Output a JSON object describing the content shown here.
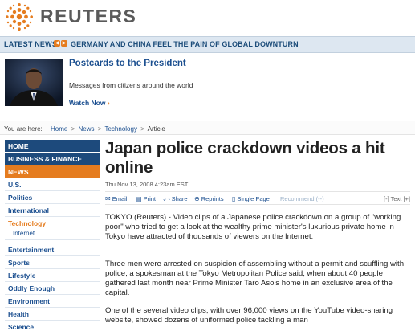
{
  "brand": {
    "name": "REUTERS",
    "color": "#e57c1f"
  },
  "ticker": {
    "label": "LATEST NEWS",
    "headline": "GERMANY AND CHINA FEEL THE PAIN OF GLOBAL DOWNTURN"
  },
  "promo": {
    "title": "Postcards to the President",
    "description": "Messages from citizens around the world",
    "link": "Watch Now",
    "link_arrow": "›"
  },
  "breadcrumb": {
    "label": "You are here:",
    "items": [
      "Home",
      "News",
      "Technology"
    ],
    "current": "Article",
    "separator": ">"
  },
  "nav": {
    "items": [
      {
        "label": "HOME",
        "style": "dark"
      },
      {
        "label": "BUSINESS & FINANCE",
        "style": "dark"
      },
      {
        "label": "NEWS",
        "style": "orange"
      },
      {
        "label": "U.S.",
        "style": "plain"
      },
      {
        "label": "Politics",
        "style": "plain"
      },
      {
        "label": "International",
        "style": "plain"
      },
      {
        "label": "Technology",
        "style": "selected"
      },
      {
        "label": "Internet",
        "style": "sub"
      },
      {
        "label": "Entertainment",
        "style": "plain-gap"
      },
      {
        "label": "Sports",
        "style": "plain"
      },
      {
        "label": "Lifestyle",
        "style": "plain"
      },
      {
        "label": "Oddly Enough",
        "style": "plain"
      },
      {
        "label": "Environment",
        "style": "plain"
      },
      {
        "label": "Health",
        "style": "plain"
      },
      {
        "label": "Science",
        "style": "plain"
      }
    ]
  },
  "article": {
    "title": "Japan police crackdown videos a hit online",
    "date": "Thu Nov 13, 2008 4:23am EST",
    "tools": {
      "email": "Email",
      "print": "Print",
      "share": "Share",
      "reprints": "Reprints",
      "single_page": "Single Page",
      "recommend": "Recommend (--)",
      "text_size": "[-] Text [+]"
    },
    "paragraphs": [
      "TOKYO (Reuters) - Video clips of a Japanese police crackdown on a group of \"working poor\" who tried to get a look at the wealthy prime minister's luxurious private home in Tokyo have attracted of thousands of viewers on the Internet.",
      "Three men were arrested on suspicion of assembling without a permit and scuffling with police, a spokesman at the Tokyo Metropolitan Police said, when about 40 people gathered last month near Prime Minister Taro Aso's home in an exclusive area of the capital.",
      "One of the several video clips, with over 96,000 views on the YouTube video-sharing website, showed dozens of uniformed police tackling a man"
    ]
  }
}
